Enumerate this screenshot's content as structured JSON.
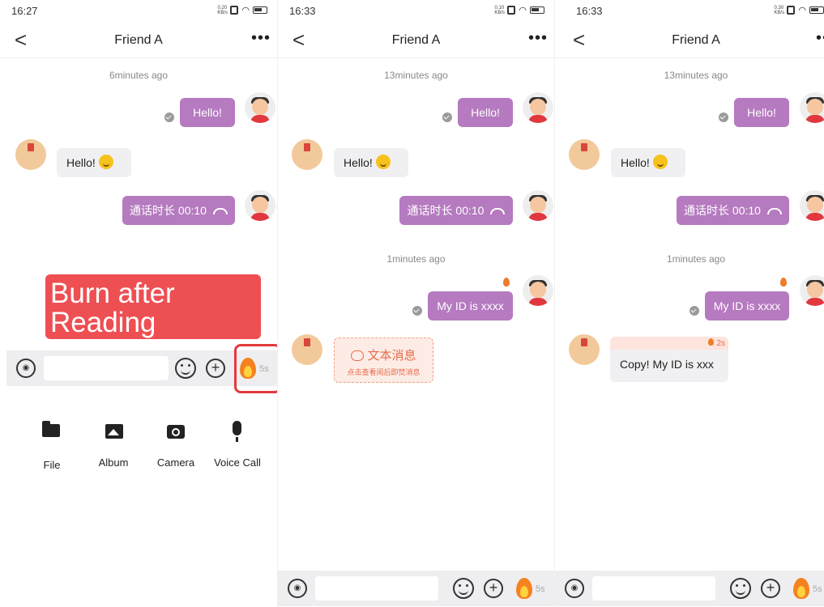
{
  "panels": [
    {
      "status": {
        "time": "16:27",
        "net_speed": "0.20\nKB/s"
      },
      "header": {
        "title": "Friend A",
        "back": "<",
        "more": "•••"
      },
      "timestamp_1": "6minutes ago",
      "messages": {
        "me_hello": "Hello!",
        "friend_hello": "Hello!",
        "call": "通话时长 00:10"
      },
      "burn_label": "Burn after Reading",
      "input": {
        "burn_seconds": "5s"
      },
      "attachments": [
        {
          "label": "File",
          "icon": "folder-icon"
        },
        {
          "label": "Album",
          "icon": "image-icon"
        },
        {
          "label": "Camera",
          "icon": "camera-icon"
        },
        {
          "label": "Voice Call",
          "icon": "microphone-icon"
        }
      ]
    },
    {
      "status": {
        "time": "16:33",
        "net_speed": "0.10\nKB/s"
      },
      "header": {
        "title": "Friend A",
        "back": "<",
        "more": "•••"
      },
      "timestamp_1": "13minutes ago",
      "timestamp_2": "1minutes ago",
      "messages": {
        "me_hello": "Hello!",
        "friend_hello": "Hello!",
        "call": "通话时长 00:10",
        "my_id": "My ID is xxxx",
        "burn_title": "文本消息",
        "burn_hint": "点击查看阅后即焚消息"
      },
      "input": {
        "burn_seconds": "5s"
      }
    },
    {
      "status": {
        "time": "16:33",
        "net_speed": "0.30\nKB/s"
      },
      "header": {
        "title": "Friend A",
        "back": "<",
        "more": "•••"
      },
      "timestamp_1": "13minutes ago",
      "timestamp_2": "1minutes ago",
      "messages": {
        "me_hello": "Hello!",
        "friend_hello": "Hello!",
        "call": "通话时长 00:10",
        "my_id": "My ID is xxxx",
        "copy_text": "Copy! My ID is xxx",
        "copy_timer": "2s"
      },
      "input": {
        "burn_seconds": "5s"
      }
    }
  ],
  "colors": {
    "bubble_me": "#b57abf",
    "bubble_friend": "#f0f0f2",
    "burn_red": "#ee4f53",
    "fire": "#f5821f"
  }
}
